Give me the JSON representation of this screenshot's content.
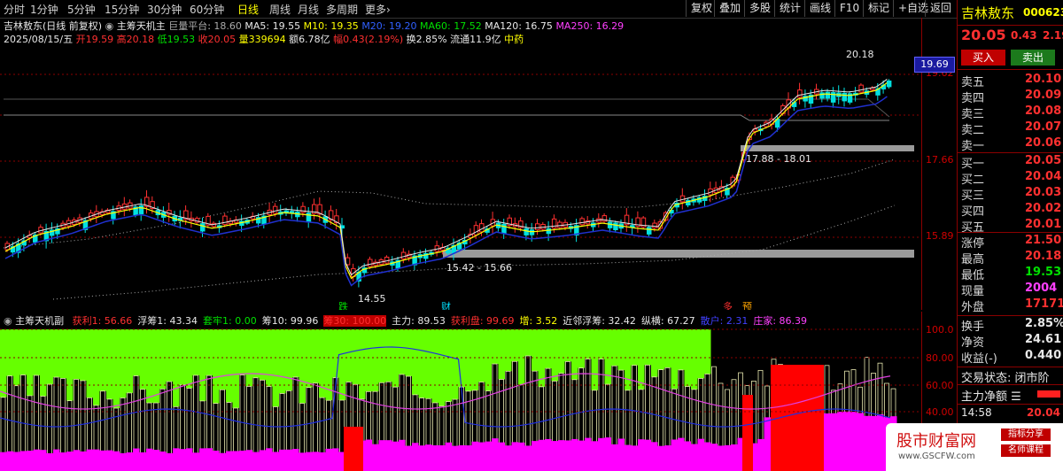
{
  "topbar": {
    "periods": [
      "分时",
      "1分钟",
      "5分钟",
      "15分钟",
      "30分钟",
      "60分钟",
      "日线",
      "周线",
      "月线",
      "多周期",
      "更多"
    ],
    "active_period": "日线",
    "tools": [
      "复权",
      "叠加",
      "多股",
      "统计",
      "画线",
      "F10",
      "标记",
      "+自选",
      "返回"
    ]
  },
  "header": {
    "stock_name": "吉林敖东",
    "mode": "(日线 前复权)",
    "indicator_name": "主筹天机主",
    "platform_label": "巨量平台",
    "platform_value": "18.60",
    "ma5": "MA5: 19.55",
    "ma10": "M10: 19.35",
    "ma20": "M20: 19.20",
    "ma60": "MA60: 17.52",
    "ma120": "MA120: 16.75",
    "ma250": "MA250: 16.29"
  },
  "infoline": {
    "date": "2025/08/15/五",
    "open_label": "开",
    "open": "19.59",
    "high_label": "高",
    "high": "20.18",
    "low_label": "低",
    "low": "19.53",
    "close_label": "收",
    "close": "20.05",
    "vol_label": "量",
    "vol": "339694",
    "amt_label": "额",
    "amt": "6.78亿",
    "chg_label": "幅",
    "chg": "0.43(2.19%)",
    "turn": "换2.85%",
    "float": "流通11.9亿",
    "industry": "中药"
  },
  "price_scale": {
    "ticks": [
      "19.62",
      "17.66",
      "15.89"
    ],
    "current": "19.69"
  },
  "annotations": {
    "high_mark": "20.18",
    "low_mark": "14.55",
    "zone_high": "17.88 - 18.01",
    "zone_low": "15.42 - 15.66",
    "mark_die": "跌",
    "mark_cai": "财",
    "mark_duo": "多",
    "mark_yu": "预"
  },
  "sub_header": {
    "name": "主筹天机副",
    "items": [
      {
        "label": "获利1: 56.66",
        "color": "#ff3030"
      },
      {
        "label": "浮筹1: 43.34",
        "color": "#e8e8e8"
      },
      {
        "label": "套牢1: 0.00",
        "color": "#00e000"
      },
      {
        "label": "筹10: 99.96",
        "color": "#e8e8e8"
      },
      {
        "label": "筹30: 100.00",
        "color": "#ff3030",
        "bg": "#c00000"
      },
      {
        "label": "主力: 89.53",
        "color": "#e8e8e8"
      },
      {
        "label": "获利盘: 99.69",
        "color": "#ff3030"
      },
      {
        "label": "增: 3.52",
        "color": "#ffff00"
      },
      {
        "label": "近邻浮筹: 32.42",
        "color": "#e8e8e8"
      },
      {
        "label": "纵横: 67.27",
        "color": "#e8e8e8"
      },
      {
        "label": "散户: 2.31",
        "color": "#4040ff"
      },
      {
        "label": "庄家: 86.39",
        "color": "#ff40ff"
      }
    ]
  },
  "sub_scale": {
    "ticks": [
      "100.0",
      "80.00",
      "60.00",
      "40.00"
    ]
  },
  "right_panel": {
    "name": "吉林敖东",
    "code": "000623",
    "price": "20.05",
    "change": "0.43",
    "pct": "2.19",
    "buy_btn": "买入",
    "sell_btn": "卖出",
    "asks": [
      {
        "label": "卖五",
        "val": "20.10"
      },
      {
        "label": "卖四",
        "val": "20.09"
      },
      {
        "label": "卖三",
        "val": "20.08"
      },
      {
        "label": "卖二",
        "val": "20.07"
      },
      {
        "label": "卖一",
        "val": "20.06"
      }
    ],
    "bids": [
      {
        "label": "买一",
        "val": "20.05"
      },
      {
        "label": "买二",
        "val": "20.04"
      },
      {
        "label": "买三",
        "val": "20.03"
      },
      {
        "label": "买四",
        "val": "20.02"
      },
      {
        "label": "买五",
        "val": "20.01"
      }
    ],
    "stats": [
      {
        "label": "涨停",
        "val": "21.50",
        "color": "#ff3030"
      },
      {
        "label": "最高",
        "val": "20.18",
        "color": "#ff3030"
      },
      {
        "label": "最低",
        "val": "19.53",
        "color": "#00e000"
      },
      {
        "label": "现量",
        "val": "2004",
        "color": "#ff40ff"
      },
      {
        "label": "外盘",
        "val": "171718",
        "color": "#ff3030"
      }
    ],
    "stats2": [
      {
        "label": "换手",
        "val": "2.85%",
        "color": "#e8e8e8"
      },
      {
        "label": "净资",
        "val": "24.61",
        "color": "#e8e8e8"
      },
      {
        "label": "收益(-)",
        "val": "0.440",
        "color": "#e8e8e8"
      }
    ],
    "trade_status": "交易状态: 闭市阶",
    "main_net": "主力净额",
    "time": "14:58",
    "last_price": "20.04"
  },
  "watermark": {
    "title": "股市财富网",
    "tag1": "指标分享",
    "tag2": "名师课程",
    "url": "www.GSCFW.com"
  }
}
